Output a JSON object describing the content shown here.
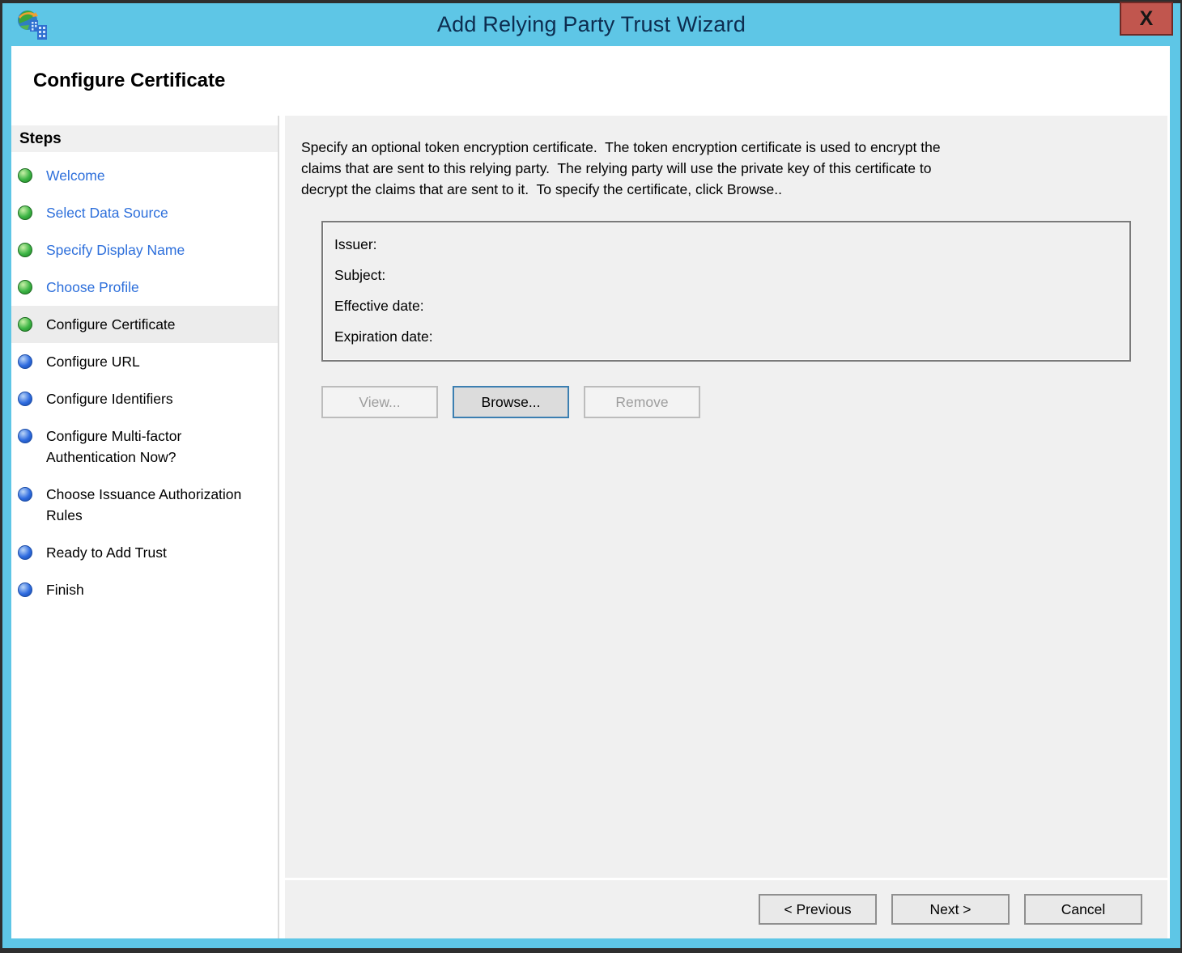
{
  "window": {
    "title": "Add Relying Party Trust Wizard",
    "close_label": "X",
    "page_title": "Configure Certificate"
  },
  "sidebar": {
    "heading": "Steps",
    "items": [
      {
        "label": "Welcome",
        "state": "completed"
      },
      {
        "label": "Select Data Source",
        "state": "completed"
      },
      {
        "label": "Specify Display Name",
        "state": "completed"
      },
      {
        "label": "Choose Profile",
        "state": "completed"
      },
      {
        "label": "Configure Certificate",
        "state": "current"
      },
      {
        "label": "Configure URL",
        "state": "upcoming"
      },
      {
        "label": "Configure Identifiers",
        "state": "upcoming"
      },
      {
        "label": "Configure Multi-factor Authentication Now?",
        "state": "upcoming"
      },
      {
        "label": "Choose Issuance Authorization Rules",
        "state": "upcoming"
      },
      {
        "label": "Ready to Add Trust",
        "state": "upcoming"
      },
      {
        "label": "Finish",
        "state": "upcoming"
      }
    ]
  },
  "main": {
    "description_lines": [
      "Specify an optional token encryption certificate.  The token encryption certificate is used to encrypt the",
      "claims that are sent to this relying party.  The relying party will use the private key of this certificate to",
      "decrypt the claims that are sent to it.  To specify the certificate, click Browse.."
    ],
    "certificate": {
      "fields": [
        "Issuer:",
        "Subject:",
        "Effective date:",
        "Expiration date:"
      ]
    },
    "buttons": [
      {
        "label": "View...",
        "enabled": false,
        "focused": false
      },
      {
        "label": "Browse...",
        "enabled": true,
        "focused": true
      },
      {
        "label": "Remove",
        "enabled": false,
        "focused": false
      }
    ]
  },
  "footer": {
    "buttons": [
      {
        "label": "< Previous",
        "enabled": true
      },
      {
        "label": "Next >",
        "enabled": true
      },
      {
        "label": "Cancel",
        "enabled": true
      }
    ]
  },
  "colors": {
    "titlebar_blue": "#5ec6e6",
    "title_text": "#0d2d50",
    "close_red": "#c1564e",
    "close_border": "#6e2a26",
    "link_blue": "#2d6fdb",
    "bullet_green": "#3cb545",
    "bullet_blue": "#2f6ce0",
    "panel_gray": "#f0f0f0",
    "focus_border_blue": "#3c7fb1",
    "outer_dark": "#2e2e2e"
  }
}
